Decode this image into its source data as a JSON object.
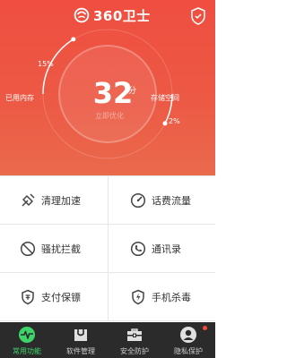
{
  "header": {
    "app_name": "360卫士",
    "logo_icon": "360-logo-icon",
    "shield_icon": "shield-icon"
  },
  "status": {
    "score": "32",
    "score_unit": "分",
    "action_label": "立即优化",
    "memory_label": "已用内存",
    "memory_percent": "15%",
    "memory_fraction": 0.15,
    "storage_label": "存储空间",
    "storage_percent": "2%",
    "storage_fraction": 0.02
  },
  "features": [
    {
      "label": "清理加速",
      "icon": "broom-icon"
    },
    {
      "label": "话费流量",
      "icon": "speedometer-icon"
    },
    {
      "label": "骚扰拦截",
      "icon": "block-icon"
    },
    {
      "label": "通讯录",
      "icon": "phone-icon"
    },
    {
      "label": "支付保镖",
      "icon": "payment-shield-icon"
    },
    {
      "label": "手机杀毒",
      "icon": "antivirus-shield-icon"
    }
  ],
  "tabs": [
    {
      "label": "常用功能",
      "icon": "pulse-icon",
      "active": true
    },
    {
      "label": "软件管理",
      "icon": "bag-icon",
      "active": false
    },
    {
      "label": "安全防护",
      "icon": "toolbox-icon",
      "active": false
    },
    {
      "label": "隐私保护",
      "icon": "privacy-person-icon",
      "active": false,
      "badge": true
    }
  ],
  "colors": {
    "hero": "#ef4e40",
    "tab_active": "#3fd46a",
    "tabbar": "#2b2b2b",
    "badge": "#f04b3c"
  }
}
